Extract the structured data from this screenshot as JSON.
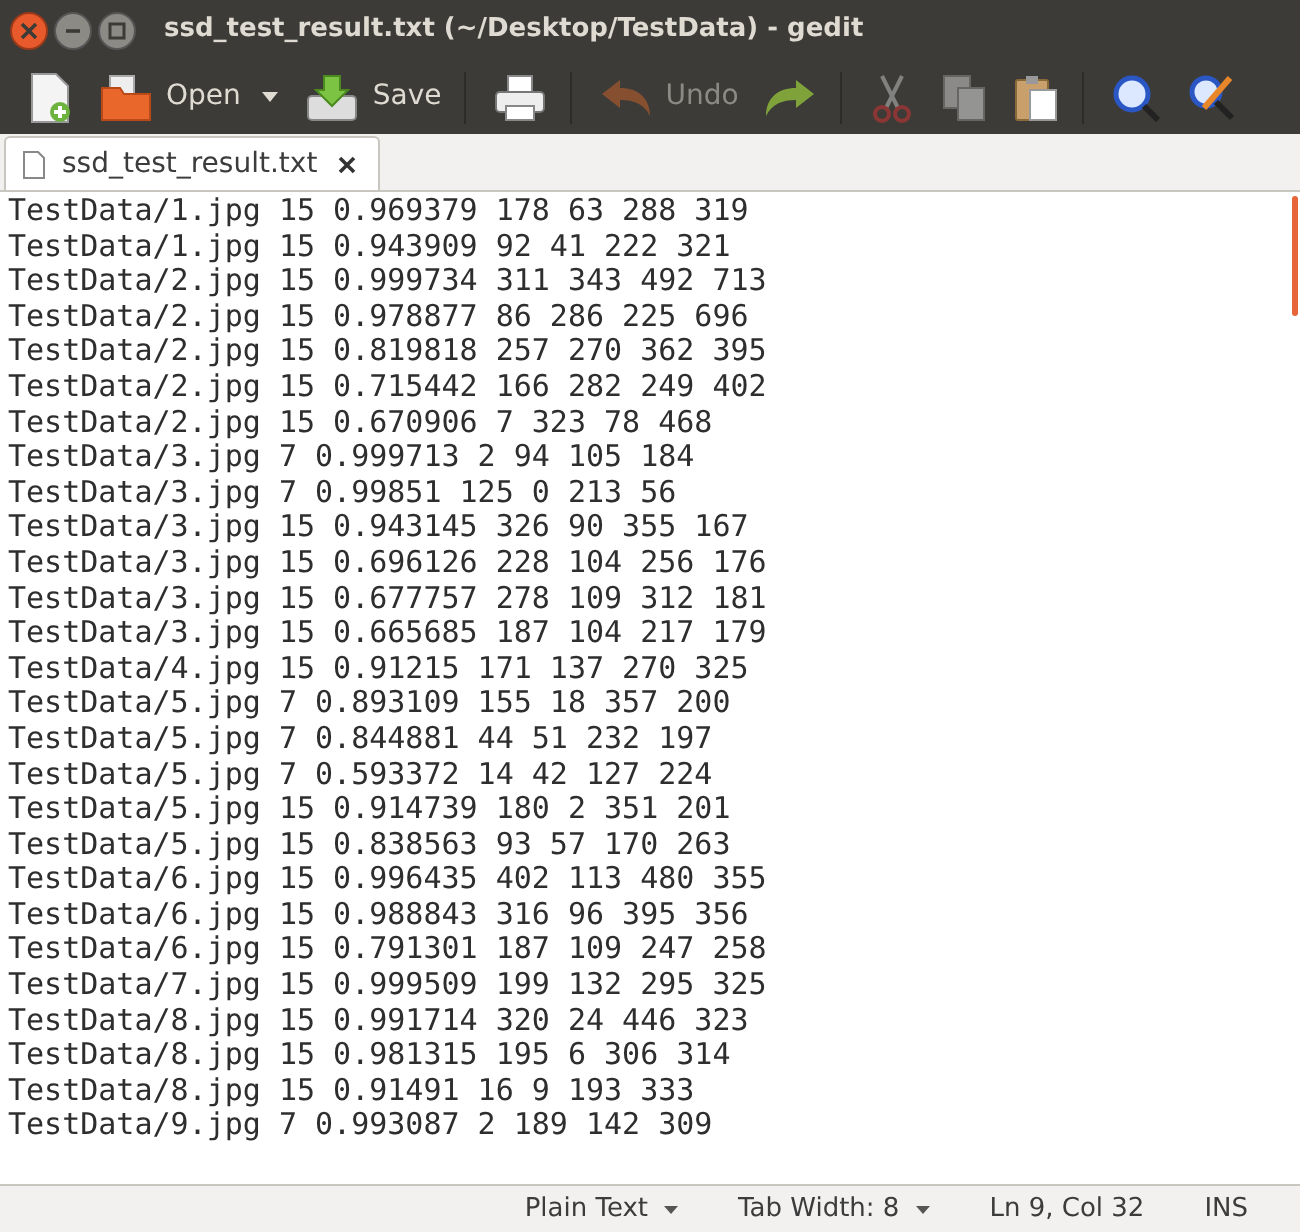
{
  "window": {
    "title": "ssd_test_result.txt (~/Desktop/TestData) - gedit"
  },
  "toolbar": [
    {
      "kind": "new",
      "disabled": false
    },
    {
      "kind": "open",
      "label": "Open",
      "dropdown": true,
      "disabled": false
    },
    {
      "kind": "save",
      "label": "Save",
      "separator_after": true,
      "disabled": false
    },
    {
      "kind": "print",
      "separator_after": true,
      "disabled": false
    },
    {
      "kind": "undo",
      "label": "Undo",
      "disabled": true
    },
    {
      "kind": "redo",
      "separator_after": true,
      "disabled": false
    },
    {
      "kind": "cut",
      "disabled": true
    },
    {
      "kind": "copy",
      "disabled": true
    },
    {
      "kind": "paste",
      "separator_after": true,
      "disabled": false
    },
    {
      "kind": "find",
      "disabled": false
    },
    {
      "kind": "replace",
      "disabled": false
    }
  ],
  "tabs": [
    {
      "label": "ssd_test_result.txt",
      "selected": true
    }
  ],
  "editor": {
    "lines": [
      "TestData/1.jpg 15 0.969379 178 63 288 319",
      "TestData/1.jpg 15 0.943909 92 41 222 321",
      "TestData/2.jpg 15 0.999734 311 343 492 713",
      "TestData/2.jpg 15 0.978877 86 286 225 696",
      "TestData/2.jpg 15 0.819818 257 270 362 395",
      "TestData/2.jpg 15 0.715442 166 282 249 402",
      "TestData/2.jpg 15 0.670906 7 323 78 468",
      "TestData/3.jpg 7 0.999713 2 94 105 184",
      "TestData/3.jpg 7 0.99851 125 0 213 56",
      "TestData/3.jpg 15 0.943145 326 90 355 167",
      "TestData/3.jpg 15 0.696126 228 104 256 176",
      "TestData/3.jpg 15 0.677757 278 109 312 181",
      "TestData/3.jpg 15 0.665685 187 104 217 179",
      "TestData/4.jpg 15 0.91215 171 137 270 325",
      "TestData/5.jpg 7 0.893109 155 18 357 200",
      "TestData/5.jpg 7 0.844881 44 51 232 197",
      "TestData/5.jpg 7 0.593372 14 42 127 224",
      "TestData/5.jpg 15 0.914739 180 2 351 201",
      "TestData/5.jpg 15 0.838563 93 57 170 263",
      "TestData/6.jpg 15 0.996435 402 113 480 355",
      "TestData/6.jpg 15 0.988843 316 96 395 356",
      "TestData/6.jpg 15 0.791301 187 109 247 258",
      "TestData/7.jpg 15 0.999509 199 132 295 325",
      "TestData/8.jpg 15 0.991714 320 24 446 323",
      "TestData/8.jpg 15 0.981315 195 6 306 314",
      "TestData/8.jpg 15 0.91491 16 9 193 333",
      "TestData/9.jpg 7 0.993087 2 189 142 309"
    ]
  },
  "status_bar": [
    {
      "label": "Plain Text",
      "dropdown": true
    },
    {
      "label": "Tab Width: 8",
      "dropdown": true
    },
    {
      "label": "Ln 9, Col 32",
      "dropdown": false
    },
    {
      "label": "INS",
      "dropdown": false
    }
  ]
}
